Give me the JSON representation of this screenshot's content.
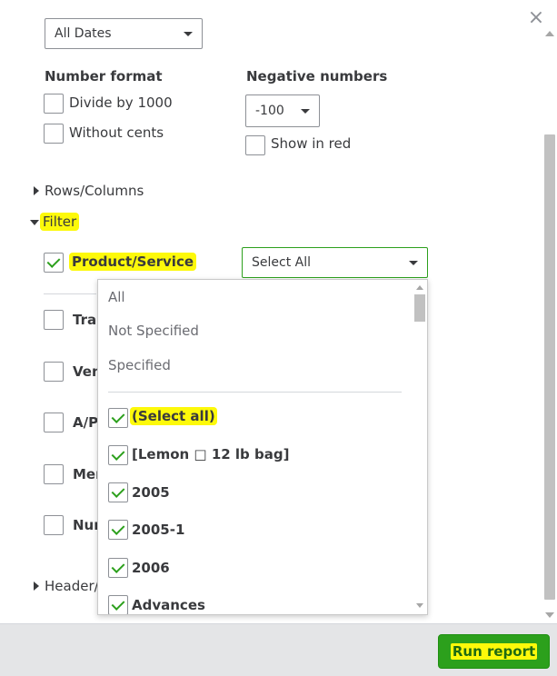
{
  "window": {
    "close_label": "×"
  },
  "dates": {
    "value": "All Dates"
  },
  "number_format": {
    "heading": "Number format",
    "divide_label": "Divide by 1000",
    "without_cents_label": "Without cents"
  },
  "negative_numbers": {
    "heading": "Negative numbers",
    "value": "-100",
    "show_red_label": "Show in red"
  },
  "sections": {
    "rows_columns": "Rows/Columns",
    "filter": "Filter",
    "header": "Header/"
  },
  "filter": {
    "product_service_label": "Product/Service",
    "product_service_value": "Select All",
    "rows_clipped": [
      "Tran",
      "Ven",
      "A/P",
      "Mer",
      "Nur"
    ]
  },
  "dropdown": {
    "options": [
      "All",
      "Not Specified",
      "Specified"
    ],
    "checked_items": [
      "(Select all)",
      "[Lemon □ 12 lb bag]",
      "2005",
      "2005-1",
      "2006",
      "Advances"
    ]
  },
  "footer": {
    "run_report_label": "Run report"
  },
  "colors": {
    "accent": "#2ca01c",
    "highlight": "#fdf90a",
    "footer_bg": "#e4e5e7"
  }
}
